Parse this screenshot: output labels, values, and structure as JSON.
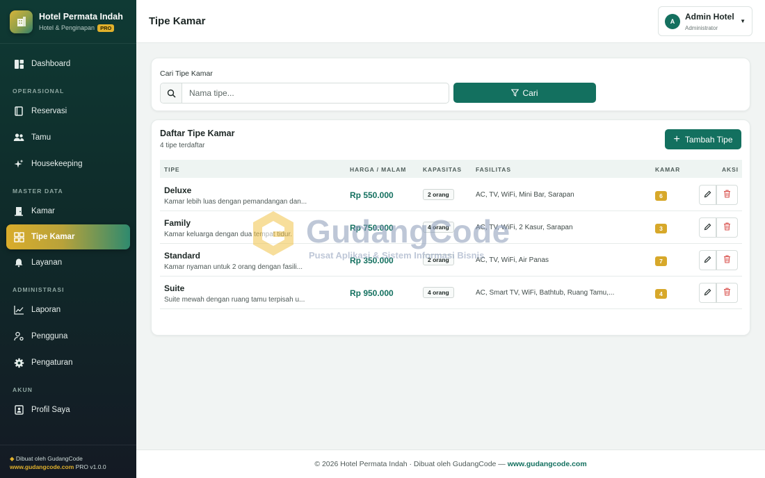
{
  "brand": {
    "name": "Hotel Permata Indah",
    "subtitle": "Hotel & Penginapan",
    "badge": "PRO"
  },
  "sidebar": {
    "dashboard": "Dashboard",
    "sections": {
      "operasional": "OPERASIONAL",
      "master": "MASTER DATA",
      "administrasi": "ADMINISTRASI",
      "akun": "AKUN"
    },
    "items": {
      "reservasi": "Reservasi",
      "tamu": "Tamu",
      "housekeeping": "Housekeeping",
      "kamar": "Kamar",
      "tipe_kamar": "Tipe Kamar",
      "layanan": "Layanan",
      "laporan": "Laporan",
      "pengguna": "Pengguna",
      "pengaturan": "Pengaturan",
      "profil": "Profil Saya"
    },
    "footer": {
      "credit": "Dibuat oleh GudangCode",
      "site": "www.gudangcode.com",
      "version": "PRO v1.0.0"
    }
  },
  "topbar": {
    "title": "Tipe Kamar",
    "user_initial": "A",
    "user_name": "Admin Hotel",
    "user_role": "Administrator"
  },
  "search": {
    "label": "Cari Tipe Kamar",
    "placeholder": "Nama tipe...",
    "button": "Cari"
  },
  "list": {
    "title": "Daftar Tipe Kamar",
    "subtitle": "4 tipe terdaftar",
    "add_button": "Tambah Tipe",
    "columns": {
      "tipe": "TIPE",
      "harga": "HARGA / MALAM",
      "kapasitas": "KAPASITAS",
      "fasilitas": "FASILITAS",
      "kamar": "KAMAR",
      "aksi": "AKSI"
    },
    "rows": [
      {
        "name": "Deluxe",
        "desc": "Kamar lebih luas dengan pemandangan dan...",
        "price": "Rp 550.000",
        "capacity": "2 orang",
        "facilities": "AC, TV, WiFi, Mini Bar, Sarapan",
        "rooms": "6"
      },
      {
        "name": "Family",
        "desc": "Kamar keluarga dengan dua tempat tidur.",
        "price": "Rp 750.000",
        "capacity": "4 orang",
        "facilities": "AC, TV, WiFi, 2 Kasur, Sarapan",
        "rooms": "3"
      },
      {
        "name": "Standard",
        "desc": "Kamar nyaman untuk 2 orang dengan fasili...",
        "price": "Rp 350.000",
        "capacity": "2 orang",
        "facilities": "AC, TV, WiFi, Air Panas",
        "rooms": "7"
      },
      {
        "name": "Suite",
        "desc": "Suite mewah dengan ruang tamu terpisah u...",
        "price": "Rp 950.000",
        "capacity": "4 orang",
        "facilities": "AC, Smart TV, WiFi, Bathtub, Ruang Tamu,...",
        "rooms": "4"
      }
    ]
  },
  "watermark": {
    "title": "GudangCode",
    "tagline": "Pusat Aplikasi & Sistem Informasi Bisnis"
  },
  "footer": {
    "text": "© 2026 Hotel Permata Indah · Dibuat oleh GudangCode — ",
    "link": "www.gudangcode.com"
  },
  "colors": {
    "primary": "#13705f",
    "accent": "#d7a82a",
    "danger": "#d9534f"
  }
}
